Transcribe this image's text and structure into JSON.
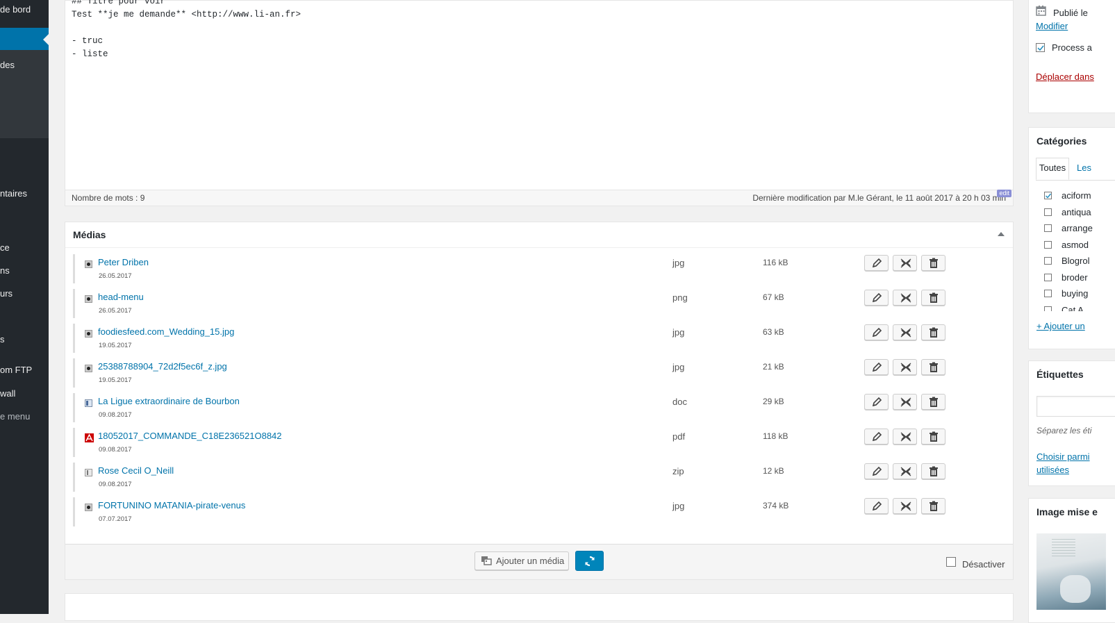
{
  "admin_menu": {
    "items": [
      {
        "label": "de bord"
      },
      {
        "label": "des"
      },
      {
        "label": "ntaires"
      },
      {
        "label": "ce"
      },
      {
        "label": "ns"
      },
      {
        "label": "urs"
      },
      {
        "label": "s"
      },
      {
        "label": "om FTP"
      },
      {
        "label": "wall"
      },
      {
        "label": "e menu"
      }
    ]
  },
  "editor": {
    "content": "## Titre pour voir\nTest **je me demande** <http://www.li-an.fr>\n\n- truc\n- liste",
    "word_count": "Nombre de mots : 9",
    "last_modified": "Dernière modification par M.le Gérant, le 11 août 2017 à 20 h 03 min",
    "badge": "edit"
  },
  "media": {
    "title": "Médias",
    "files": [
      {
        "name": "Peter Driben",
        "date": "26.05.2017",
        "type": "jpg",
        "size": "116 kB",
        "icon": "image-file-icon"
      },
      {
        "name": "head-menu",
        "date": "26.05.2017",
        "type": "png",
        "size": "67 kB",
        "icon": "image-file-icon"
      },
      {
        "name": "foodiesfeed.com_Wedding_15.jpg",
        "date": "19.05.2017",
        "type": "jpg",
        "size": "63 kB",
        "icon": "image-file-icon"
      },
      {
        "name": "25388788904_72d2f5ec6f_z.jpg",
        "date": "19.05.2017",
        "type": "jpg",
        "size": "21 kB",
        "icon": "image-file-icon"
      },
      {
        "name": "La Ligue extraordinaire de Bourbon",
        "date": "09.08.2017",
        "type": "doc",
        "size": "29 kB",
        "icon": "document-file-icon"
      },
      {
        "name": "18052017_COMMANDE_C18E236521O8842",
        "date": "09.08.2017",
        "type": "pdf",
        "size": "118 kB",
        "icon": "pdf-file-icon"
      },
      {
        "name": "Rose Cecil O_Neill",
        "date": "09.08.2017",
        "type": "zip",
        "size": "12 kB",
        "icon": "archive-file-icon"
      },
      {
        "name": "FORTUNINO MATANIA-pirate-venus",
        "date": "07.07.2017",
        "type": "jpg",
        "size": "374 kB",
        "icon": "image-file-icon"
      }
    ],
    "add_button": "Ajouter un média",
    "deactivate": "Désactiver"
  },
  "publish": {
    "published_label": "Publié le",
    "modify_link": "Modifier",
    "process_label": "Process a",
    "trash_link": "Déplacer dans"
  },
  "categories": {
    "title": "Catégories",
    "tab_all": "Toutes",
    "tab_used": "Les",
    "items": [
      {
        "label": "aciform",
        "checked": true
      },
      {
        "label": "antiqua",
        "checked": false
      },
      {
        "label": "arrange",
        "checked": false
      },
      {
        "label": "asmod",
        "checked": false
      },
      {
        "label": "Blogrol",
        "checked": false
      },
      {
        "label": "broder",
        "checked": false
      },
      {
        "label": "buying",
        "checked": false
      },
      {
        "label": "Cat A",
        "checked": false
      }
    ],
    "add_link": "+ Ajouter un"
  },
  "tags": {
    "title": "Étiquettes",
    "help": "Séparez les éti",
    "choose_link_line1": "Choisir parmi",
    "choose_link_line2": "utilisées"
  },
  "featured": {
    "title": "Image mise e"
  },
  "colors": {
    "accent": "#0073aa",
    "sidebar": "#23282d",
    "danger": "#a00"
  }
}
